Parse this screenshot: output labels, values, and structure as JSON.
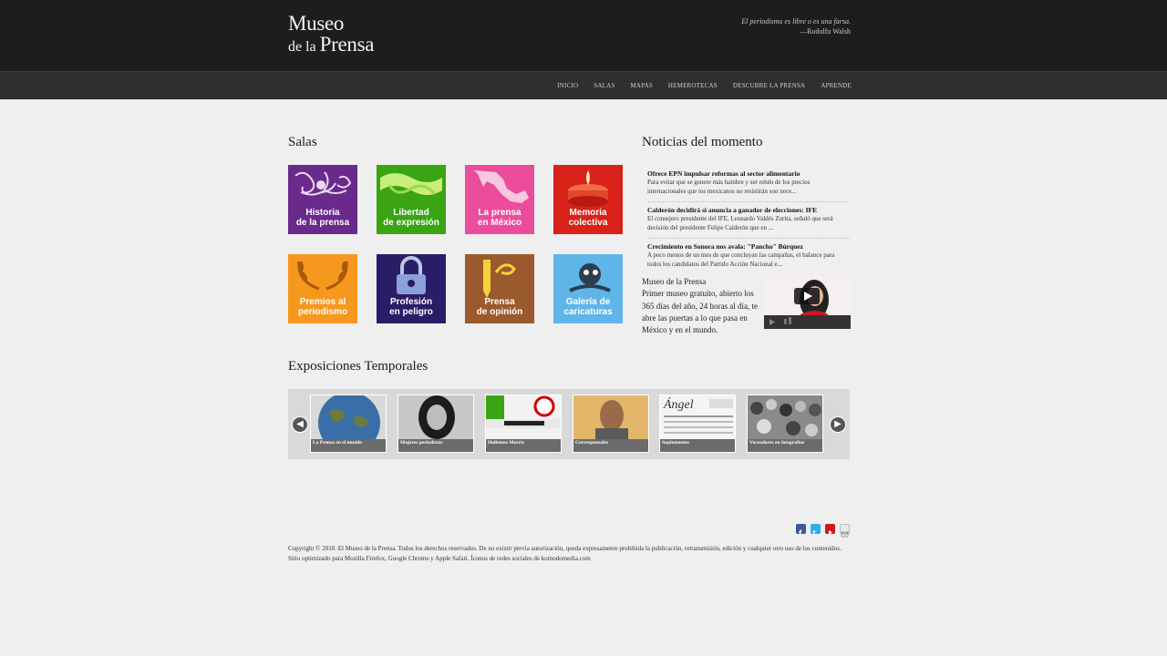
{
  "header": {
    "logo_line1": "Museo",
    "logo_line2a": "de la",
    "logo_line2b": "Prensa",
    "quote": "El periodismo es libre o es una farsa.",
    "quote_author": "—Rodolfo Walsh"
  },
  "nav": {
    "items": [
      "INICIO",
      "SALAS",
      "MAPAS",
      "HEMEROTECAS",
      "DESCUBRE LA PRENSA",
      "APRENDE"
    ]
  },
  "salas": {
    "title": "Salas",
    "tiles": [
      {
        "line1": "Historia",
        "line2": "de la prensa",
        "color": "#6a2a8c"
      },
      {
        "line1": "Libertad",
        "line2": "de expresión",
        "color": "#3aa412"
      },
      {
        "line1": "La prensa",
        "line2": "en México",
        "color": "#ec4c9c"
      },
      {
        "line1": "Memoria",
        "line2": "colectiva",
        "color": "#d8221a"
      },
      {
        "line1": "Premios al",
        "line2": "periodismo",
        "color": "#f7981e"
      },
      {
        "line1": "Profesión",
        "line2": "en peligro",
        "color": "#2a1d67"
      },
      {
        "line1": "Prensa",
        "line2": "de opinión",
        "color": "#9a5a2c"
      },
      {
        "line1": "Galería de",
        "line2": "caricaturas",
        "color": "#5fb5e8"
      }
    ]
  },
  "noticias": {
    "title": "Noticias del momento",
    "items": [
      {
        "title": "Ofrece EPN impulsar reformas al sector alimentario",
        "desc": "Para evitar que se genere más hambre y ser rehén de los precios internacionales que los mexicanos no resistirán son nece..."
      },
      {
        "title": "Calderón decidirá si anuncia a ganador de elecciones: IFE",
        "desc": "El consejero presidente del IFE, Leonardo Valdés Zurita, señaló que será decisión del presidente Felipe Calderón que en ..."
      },
      {
        "title": "Crecimiento en Sonora nos avala: \"Pancho\" Búrquez",
        "desc": "A poco menos de un mes de que concluyan las campañas, el balance para todos los candidatos del Partido Acción Nacional e..."
      }
    ],
    "museo_title": "Museo de la Prensa",
    "museo_text": "Primer museo gratuito, abierto los 365 días del año, 24 horas al día, te abre las puertas a lo que pasa en México y en el mundo."
  },
  "exposiciones": {
    "title": "Exposiciones Temporales",
    "items": [
      {
        "caption": "La Prensa en el mundo"
      },
      {
        "caption": "Mujeres periodistas"
      },
      {
        "caption": "Hollemos Morris"
      },
      {
        "caption": "Corresponsales"
      },
      {
        "caption": "Suplementos"
      },
      {
        "caption": "Voceadores en fotografías"
      }
    ],
    "prev": "◀",
    "next": "▶"
  },
  "social": [
    {
      "icon": "facebook-icon",
      "color": "#3b5998"
    },
    {
      "icon": "twitter-icon",
      "color": "#33aee8"
    },
    {
      "icon": "youtube-icon",
      "color": "#cc181e"
    },
    {
      "icon": "mail-icon",
      "color": "#e8e8e8"
    }
  ],
  "footer": {
    "text": "Copyright © 2010. El Museo de la Prensa. Todos los derechos reservados. De no existir previa autorización, queda expresamente prohibida la publicación, retransmisión, edición y cualquier otro uso de los contenidos. Sitio optimizado para Mozilla Firefox, Google Chrome y Apple Safari. Íconos de redes sociales de komodomedia.com"
  }
}
